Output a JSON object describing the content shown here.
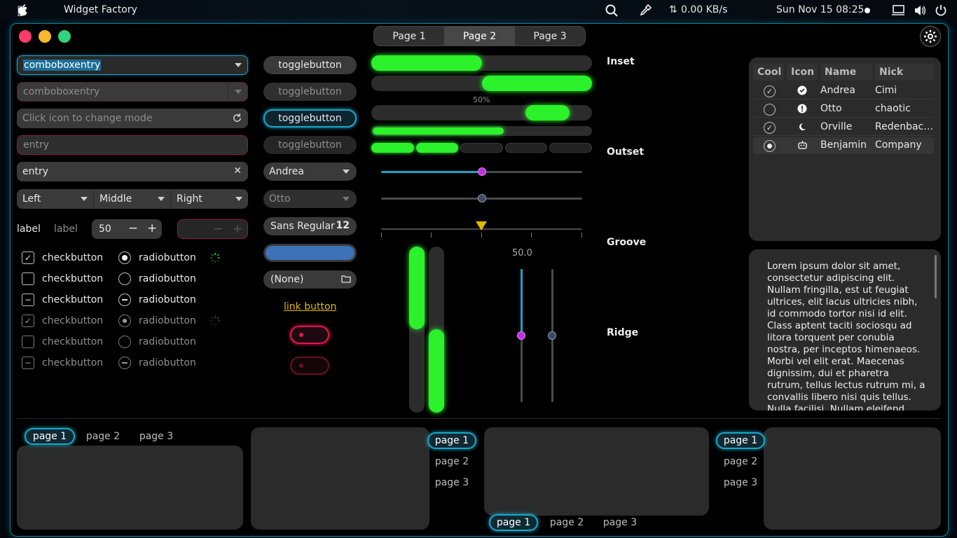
{
  "topbar": {
    "app_name": "Widget Factory",
    "network": "0.00 KB/s",
    "clock": "Sun Nov 15  08:25"
  },
  "header_tabs": [
    "Page 1",
    "Page 2",
    "Page 3"
  ],
  "col1": {
    "combo1": "comboboxentry",
    "combo2": "comboboxentry",
    "mode_placeholder": "Click icon to change mode",
    "entry_error": "entry",
    "entry_clear": "entry",
    "dropdowns": [
      "Left",
      "Middle",
      "Right"
    ],
    "label1": "label",
    "label2": "label",
    "spin_value": "50",
    "checks": [
      "checkbutton",
      "checkbutton",
      "checkbutton",
      "checkbutton",
      "checkbutton",
      "checkbutton"
    ],
    "radios": [
      "radiobutton",
      "radiobutton",
      "radiobutton",
      "radiobutton",
      "radiobutton",
      "radiobutton"
    ]
  },
  "col2": {
    "toggles": [
      "togglebutton",
      "togglebutton",
      "togglebutton",
      "togglebutton"
    ],
    "combo_andrea": "Andrea",
    "combo_otto": "Otto",
    "font_name": "Sans Regular",
    "font_size": "12",
    "color_hex": "#3d72b8",
    "file_none": "(None)",
    "link": "link button"
  },
  "col3": {
    "progress_label": "50%",
    "progress": {
      "p1": 0.5,
      "p2_start": 0.5,
      "p4": 0.6,
      "level_filled": 2,
      "level_total": 5
    },
    "scale_h1": 0.5,
    "scale_h2": 0.5,
    "scale_v_label": "50.0",
    "scale_v1": 0.5,
    "scale_v2": 0.5
  },
  "frames": [
    "Inset",
    "Outset",
    "Groove",
    "Ridge"
  ],
  "table": {
    "headers": [
      "Cool",
      "Icon",
      "Name",
      "Nick"
    ],
    "rows": [
      {
        "cool": "checked",
        "icon": "check-circle-icon",
        "name": "Andrea",
        "nick": "Cimi"
      },
      {
        "cool": "unchecked",
        "icon": "exclamation-circle-icon",
        "name": "Otto",
        "nick": "chaotic"
      },
      {
        "cool": "checked",
        "icon": "moon-icon",
        "name": "Orville",
        "nick": "Redenbac…"
      },
      {
        "cool": "radio",
        "icon": "robot-icon",
        "name": "Benjamin",
        "nick": "Company"
      }
    ]
  },
  "textview": "Lorem ipsum dolor sit amet, consectetur adipiscing elit. Nullam fringilla, est ut feugiat ultrices, elit lacus ultricies nibh, id commodo tortor nisi id elit. Class aptent taciti sociosqu ad litora torquent per conubia nostra, per inceptos himenaeos. Morbi vel elit erat. Maecenas dignissim, dui et pharetra rutrum, tellus lectus rutrum mi, a convallis libero nisi quis tellus. Nulla facilisi. Nullam eleifend",
  "notebooks": {
    "nb1": [
      "page 1",
      "page 2",
      "page 3"
    ],
    "nb2": [
      "page 1",
      "page 2",
      "page 3"
    ],
    "nb3": [
      "page 1",
      "page 2",
      "page 3"
    ],
    "nb4": [
      "page 1",
      "page 2",
      "page 3"
    ]
  },
  "colors": {
    "accent": "#1ba5c8",
    "green": "#2bf22b",
    "error": "#e0154f",
    "magenta": "#c030e0"
  }
}
